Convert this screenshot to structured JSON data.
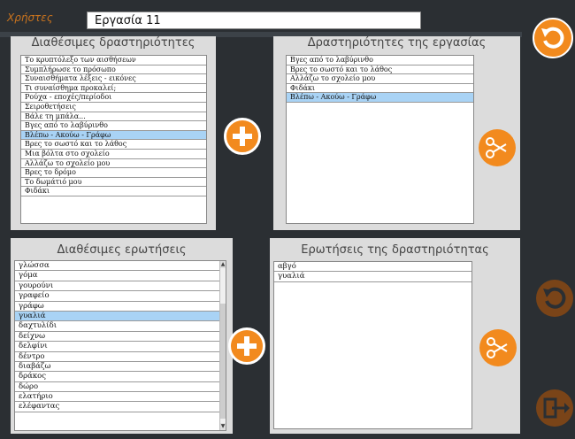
{
  "header": {
    "tab_label": "Χρήστες",
    "task_name": "Εργασία 11"
  },
  "available_activities": {
    "title": "Διαθέσιμες δραστηριότητες",
    "items": [
      "Το κρυπτόλεξο των αισθήσεων",
      "Συμπλήρωσε το πρόσωπο",
      "Συναισθήματα λέξεις - εικόνες",
      "Τι συναίσθημα προκαλεί;",
      "Ρούχα - εποχές/περίοδοι",
      "Σειροθετήσεις",
      "Βάλε τη μπάλα...",
      "Βγες από το λαβύρινθο",
      "Βλέπω - Ακούω - Γράφω",
      "Βρες το σωστό και το λάθος",
      "Μια βόλτα στο σχολείο",
      "Αλλάζω το σχολείο μου",
      "Βρες το δρόμο",
      "Το δωμάτιό μου",
      "Φιδάκι"
    ],
    "selected_index": 8
  },
  "task_activities": {
    "title": "Δραστηριότητες της εργασίας",
    "items": [
      "Βγες από το λαβύρινθο",
      "Βρες το σωστό και το λάθος",
      "Αλλάζω το σχολείο μου",
      "Φιδάκι",
      "Βλέπω - Ακούω - Γράφω"
    ],
    "selected_index": 4
  },
  "available_questions": {
    "title": "Διαθέσιμες ερωτήσεις",
    "items": [
      "γλώσσα",
      "γόμα",
      "γουρούνι",
      "γραφείο",
      "γράφω",
      "γυαλιά",
      "δαχτυλίδι",
      "δείχνω",
      "δελφίνι",
      "δέντρο",
      "διαβάζω",
      "δράκος",
      "δώρο",
      "ελατήριο",
      "ελέφαντας"
    ],
    "selected_index": 5
  },
  "activity_questions": {
    "title": "Ερωτήσεις της δραστηριότητας",
    "items": [
      "αβγό",
      "γυαλιά"
    ]
  },
  "colors": {
    "accent": "#f28a1e",
    "dark_accent": "#7a4418",
    "panel": "#dcdcdc",
    "selection": "#a9d3f5"
  },
  "icons": {
    "add": "plus-icon",
    "remove": "scissors-icon",
    "undo": "undo-icon",
    "exit": "exit-icon"
  }
}
